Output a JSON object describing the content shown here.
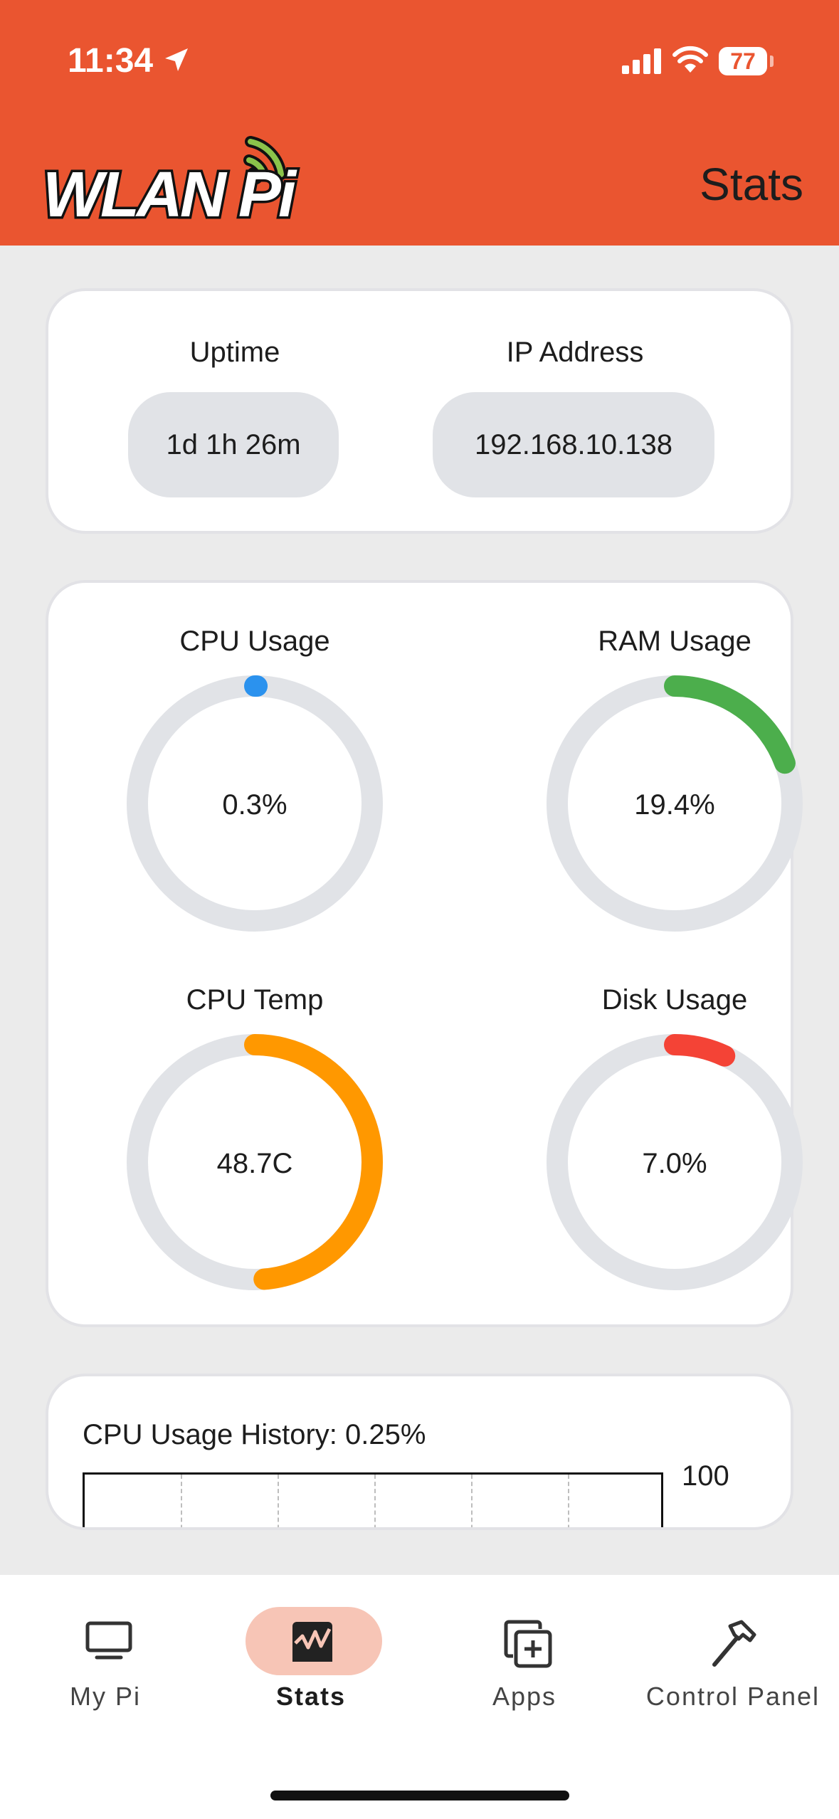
{
  "status_bar": {
    "time": "11:34",
    "battery": "77"
  },
  "header": {
    "logo_text": "WLAN Pi",
    "title": "Stats"
  },
  "summary": {
    "uptime_label": "Uptime",
    "uptime_value": "1d 1h 26m",
    "ip_label": "IP Address",
    "ip_value": "192.168.10.138"
  },
  "gauges": [
    {
      "label": "CPU Usage",
      "value": "0.3%",
      "fraction": 0.003,
      "color": "#2b92ee"
    },
    {
      "label": "RAM Usage",
      "value": "19.4%",
      "fraction": 0.194,
      "color": "#4cae4c"
    },
    {
      "label": "CPU Temp",
      "value": "48.7C",
      "fraction": 0.487,
      "color": "#ff9800"
    },
    {
      "label": "Disk Usage",
      "value": "7.0%",
      "fraction": 0.07,
      "color": "#f44336"
    }
  ],
  "history": {
    "title": "CPU Usage History: 0.25%",
    "max_label": "100"
  },
  "tabs": [
    {
      "label": "My Pi",
      "icon": "monitor-icon",
      "active": false
    },
    {
      "label": "Stats",
      "icon": "chart-icon",
      "active": true
    },
    {
      "label": "Apps",
      "icon": "add-apps-icon",
      "active": false
    },
    {
      "label": "Control Panel",
      "icon": "hammer-icon",
      "active": false
    }
  ]
}
